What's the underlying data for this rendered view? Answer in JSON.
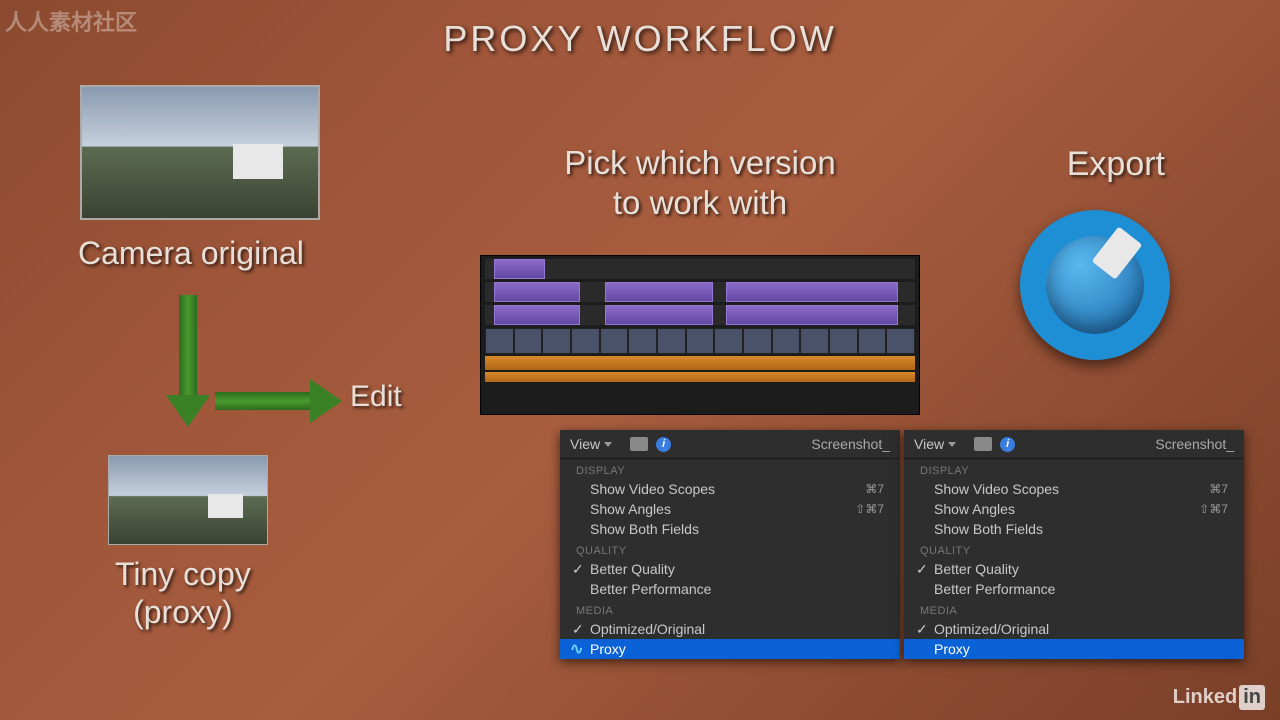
{
  "watermark": "人人素材社区",
  "title": "PROXY WORKFLOW",
  "labels": {
    "camera_original": "Camera original",
    "edit": "Edit",
    "tiny_copy_l1": "Tiny copy",
    "tiny_copy_l2": "(proxy)",
    "pick_l1": "Pick which version",
    "pick_l2": "to work with",
    "export": "Export"
  },
  "menu": {
    "view_label": "View",
    "screenshot_label": "Screenshot_",
    "sections": {
      "display": "DISPLAY",
      "quality": "QUALITY",
      "media": "MEDIA"
    },
    "items": {
      "show_video_scopes": "Show Video Scopes",
      "show_video_scopes_sc": "⌘7",
      "show_angles": "Show Angles",
      "show_angles_sc": "⇧⌘7",
      "show_both_fields": "Show Both Fields",
      "better_quality": "Better Quality",
      "better_performance": "Better Performance",
      "optimized_original": "Optimized/Original",
      "proxy": "Proxy"
    }
  },
  "footer": {
    "linkedin": "Linked",
    "linkedin_box": "in"
  }
}
